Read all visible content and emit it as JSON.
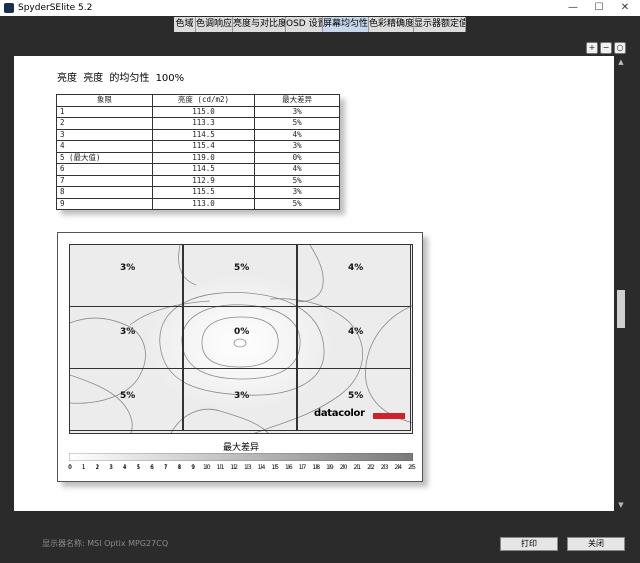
{
  "window": {
    "title": "SpyderSElite 5.2",
    "minimize": "—",
    "maximize": "☐",
    "close": "✕"
  },
  "tabs": [
    {
      "label": "色域"
    },
    {
      "label": "色调响应"
    },
    {
      "label": "亮度与对比度"
    },
    {
      "label": "OSD 设置"
    },
    {
      "label": "屏幕均匀性",
      "active": true
    },
    {
      "label": "色彩精确度"
    },
    {
      "label": "显示器额定值"
    }
  ],
  "zoom": {
    "zoom_in": "+",
    "zoom_out": "−",
    "zoom_fit": "○"
  },
  "report": {
    "title_part1": "亮度",
    "title_part2": "亮度",
    "title_part3": "的均匀性",
    "title_part4": "100%"
  },
  "table": {
    "headers": [
      "象限",
      "亮度 (cd/m2)",
      "最大差异"
    ],
    "rows": [
      [
        "1",
        "115.0",
        "3%"
      ],
      [
        "2",
        "113.3",
        "5%"
      ],
      [
        "3",
        "114.5",
        "4%"
      ],
      [
        "4",
        "115.4",
        "3%"
      ],
      [
        "5 (最大值)",
        "119.0",
        "0%"
      ],
      [
        "6",
        "114.5",
        "4%"
      ],
      [
        "7",
        "112.9",
        "5%"
      ],
      [
        "8",
        "115.5",
        "3%"
      ],
      [
        "9",
        "113.0",
        "5%"
      ]
    ]
  },
  "uniformity_map": {
    "cells": [
      "3%",
      "5%",
      "4%",
      "3%",
      "0%",
      "4%",
      "5%",
      "3%",
      "5%"
    ],
    "brand": "datacolor",
    "brand_color": "#d0202a",
    "legend_title": "最大差异",
    "legend_ticks": [
      "0",
      "1",
      "2",
      "3",
      "4",
      "5",
      "6",
      "7",
      "8",
      "9",
      "10",
      "11",
      "12",
      "13",
      "14",
      "15",
      "16",
      "17",
      "18",
      "19",
      "20",
      "21",
      "22",
      "23",
      "24",
      "25"
    ]
  },
  "footer": {
    "monitor_name": "显示器名称: MSI Optix MPG27CQ",
    "print_button": "打印",
    "close_button": "关闭"
  },
  "colors": {
    "background": "#2b2b2b",
    "active_tab": "#c8d8ec",
    "brand_red": "#d0202a"
  }
}
